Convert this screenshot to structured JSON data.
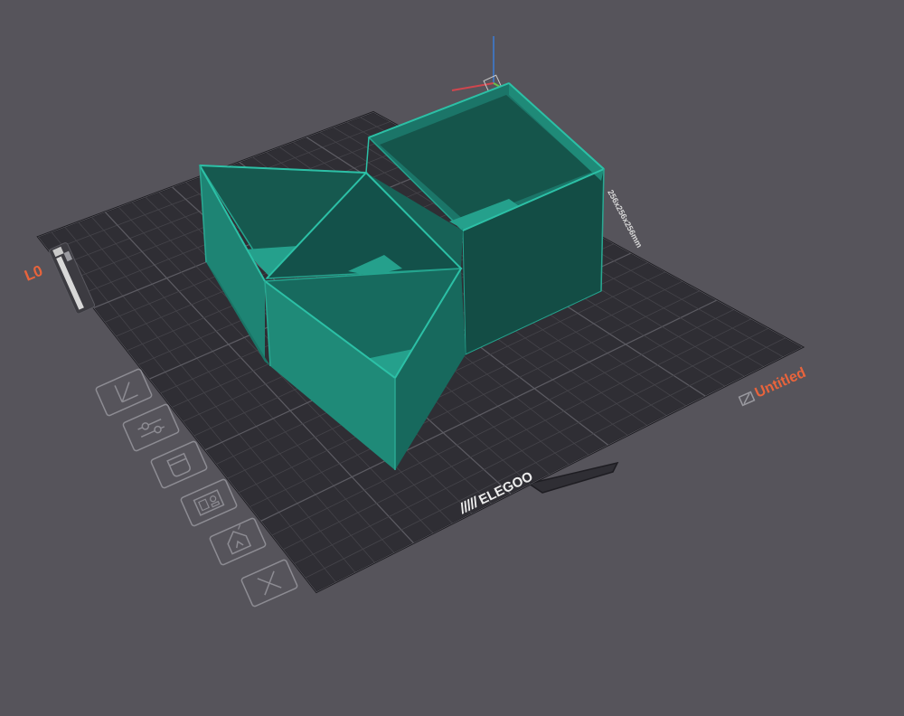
{
  "viewport": {
    "plate_label": "L0",
    "project_name": "Untitled",
    "plate_dimensions": "256x256x256mm",
    "brand_logo": "ELEGOO",
    "model_color": "#1f8a78",
    "accent_color": "#e8643c"
  },
  "plate_toolbar": {
    "icons": [
      "arrange-icon",
      "plate-settings-icon",
      "orient-icon",
      "layout-icon",
      "slice-plate-icon",
      "delete-plate-icon"
    ]
  }
}
